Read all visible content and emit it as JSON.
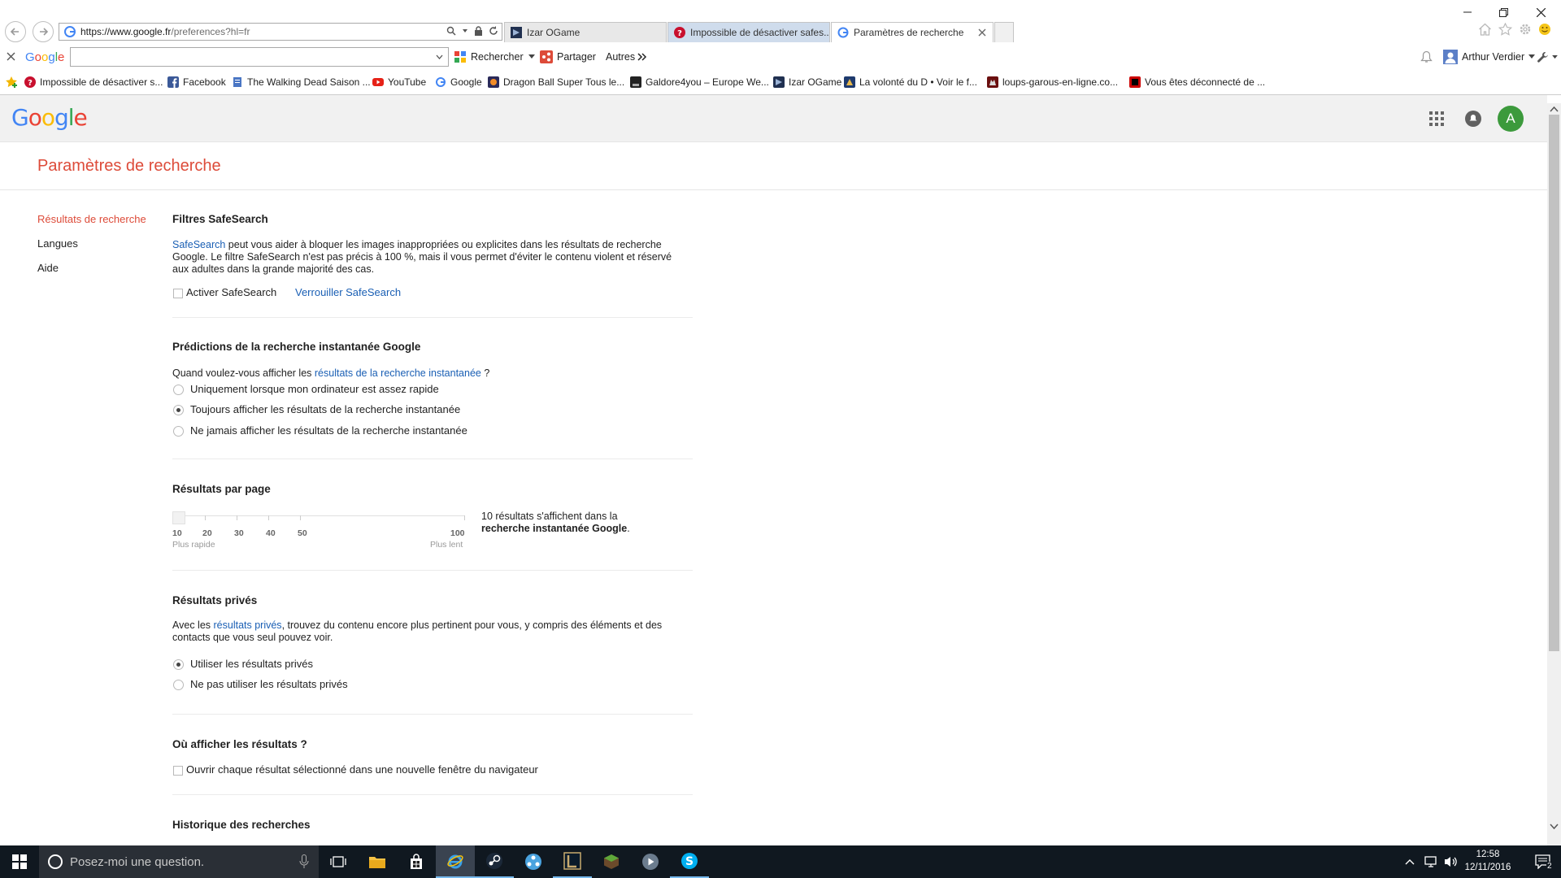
{
  "browser": {
    "url_host": "https://www.google.fr",
    "url_rest": "/preferences?hl=fr",
    "tabs": [
      {
        "label": "Izar OGame",
        "active": false
      },
      {
        "label": "Impossible de désactiver safes...",
        "active": false
      },
      {
        "label": "Paramètres de recherche",
        "active": true
      }
    ],
    "toolbar": {
      "google_label": "Google",
      "rechercher_label": "Rechercher",
      "partager_label": "Partager",
      "autres_label": "Autres",
      "user_name": "Arthur Verdier"
    },
    "favorites": [
      {
        "label": "Impossible de désactiver s...",
        "icon": "question-circle-icon",
        "color": "#c8102e"
      },
      {
        "label": "Facebook",
        "icon": "facebook-icon",
        "color": "#3b5998"
      },
      {
        "label": "The Walking Dead Saison ...",
        "icon": "page-icon",
        "color": "#4a76c4"
      },
      {
        "label": "YouTube",
        "icon": "youtube-icon",
        "color": "#e62117"
      },
      {
        "label": "Google",
        "icon": "google-icon",
        "color": "#4285f4"
      },
      {
        "label": "Dragon Ball Super  Tous le...",
        "icon": "dragonball-icon",
        "color": "#2a2a5a"
      },
      {
        "label": "Galdore4you – Europe We...",
        "icon": "page-icon",
        "color": "#222222"
      },
      {
        "label": "Izar OGame",
        "icon": "ogame-icon",
        "color": "#203050"
      },
      {
        "label": "La volonté du D • Voir le f...",
        "icon": "page-icon",
        "color": "#1e3a6e"
      },
      {
        "label": "loups-garous-en-ligne.co...",
        "icon": "wolf-icon",
        "color": "#6b1010"
      },
      {
        "label": "Vous êtes déconnecté de ...",
        "icon": "bank-icon",
        "color": "#cc0000"
      }
    ]
  },
  "page": {
    "logo": "Google",
    "avatar_letter": "A",
    "title": "Paramètres de recherche",
    "nav": [
      "Résultats de recherche",
      "Langues",
      "Aide"
    ],
    "safesearch": {
      "title": "Filtres SafeSearch",
      "link": "SafeSearch",
      "text": " peut vous aider à bloquer les images inappropriées ou explicites dans les résultats de recherche Google. Le filtre SafeSearch n'est pas précis à 100 %, mais il vous permet d'éviter le contenu violent et réservé aux adultes dans la grande majorité des cas.",
      "checkbox_label": "Activer SafeSearch",
      "checked": false,
      "lock_link": "Verrouiller SafeSearch"
    },
    "instant": {
      "title": "Prédictions de la recherche instantanée Google",
      "question_before": "Quand voulez-vous afficher les ",
      "question_link": "résultats de la recherche instantanée",
      "question_after": " ?",
      "options": [
        "Uniquement lorsque mon ordinateur est assez rapide",
        "Toujours afficher les résultats de la recherche instantanée",
        "Ne jamais afficher les résultats de la recherche instantanée"
      ],
      "selected_index": 1
    },
    "per_page": {
      "title": "Résultats par page",
      "ticks": [
        "10",
        "20",
        "30",
        "40",
        "50",
        "100"
      ],
      "faster_label": "Plus rapide",
      "slower_label": "Plus lent",
      "value": 10,
      "info_line1": "10 résultats s'affichent dans la",
      "info_line2_bold": "recherche instantanée Google",
      "info_line2_after": "."
    },
    "private": {
      "title": "Résultats privés",
      "text_before": "Avec les ",
      "text_link": "résultats privés",
      "text_after": ", trouvez du contenu encore plus pertinent pour vous, y compris des éléments et des contacts que vous seul pouvez voir.",
      "options": [
        "Utiliser les résultats privés",
        "Ne pas utiliser les résultats privés"
      ],
      "selected_index": 0
    },
    "where": {
      "title": "Où afficher les résultats ?",
      "checkbox_label": "Ouvrir chaque résultat sélectionné dans une nouvelle fenêtre du navigateur",
      "checked": false
    },
    "history": {
      "title": "Historique des recherches"
    }
  },
  "taskbar": {
    "search_placeholder": "Posez-moi une question.",
    "time": "12:58",
    "date": "12/11/2016",
    "notification_count": "2"
  },
  "colors": {
    "accent_red": "#dd4b39",
    "link_blue": "#1a5fb4",
    "avatar_green": "#3c9a3c"
  }
}
